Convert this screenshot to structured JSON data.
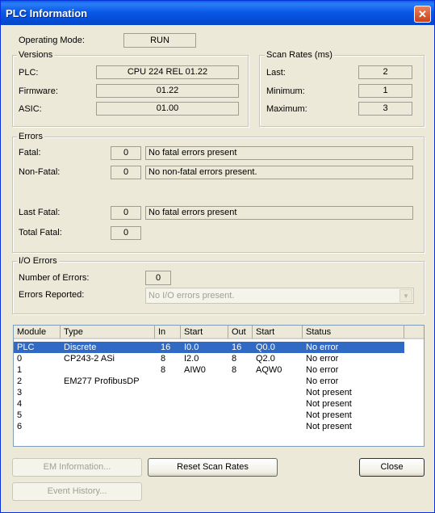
{
  "window": {
    "title": "PLC Information",
    "close_glyph": "✕"
  },
  "operating_mode": {
    "label": "Operating Mode:",
    "value": "RUN"
  },
  "versions": {
    "title": "Versions",
    "plc": {
      "label": "PLC:",
      "value": "CPU 224 REL 01.22"
    },
    "firmware": {
      "label": "Firmware:",
      "value": "01.22"
    },
    "asic": {
      "label": "ASIC:",
      "value": "01.00"
    }
  },
  "scan_rates": {
    "title": "Scan Rates (ms)",
    "last": {
      "label": "Last:",
      "value": "2"
    },
    "minimum": {
      "label": "Minimum:",
      "value": "1"
    },
    "maximum": {
      "label": "Maximum:",
      "value": "3"
    }
  },
  "errors": {
    "title": "Errors",
    "fatal": {
      "label": "Fatal:",
      "count": "0",
      "message": "No fatal errors present"
    },
    "non_fatal": {
      "label": "Non-Fatal:",
      "count": "0",
      "message": "No non-fatal errors present."
    },
    "last_fatal": {
      "label": "Last Fatal:",
      "count": "0",
      "message": "No fatal errors present"
    },
    "total_fatal": {
      "label": "Total Fatal:",
      "count": "0"
    }
  },
  "io_errors": {
    "title": "I/O Errors",
    "number": {
      "label": "Number of Errors:",
      "value": "0"
    },
    "reported": {
      "label": "Errors Reported:",
      "value": "No I/O errors present.",
      "arrow": "▼"
    }
  },
  "modules": {
    "columns": [
      "Module",
      "Type",
      "In",
      "Start",
      "Out",
      "Start",
      "Status"
    ],
    "rows": [
      [
        "PLC",
        "Discrete",
        "16",
        "I0.0",
        "16",
        "Q0.0",
        "No error"
      ],
      [
        "0",
        "CP243-2 ASi",
        "8",
        "I2.0",
        "8",
        "Q2.0",
        "No error"
      ],
      [
        "1",
        "",
        "8",
        "AIW0",
        "8",
        "AQW0",
        "No error"
      ],
      [
        "2",
        "EM277 ProfibusDP",
        "",
        "",
        "",
        "",
        "No error"
      ],
      [
        "3",
        "",
        "",
        "",
        "",
        "",
        "Not present"
      ],
      [
        "4",
        "",
        "",
        "",
        "",
        "",
        "Not present"
      ],
      [
        "5",
        "",
        "",
        "",
        "",
        "",
        "Not present"
      ],
      [
        "6",
        "",
        "",
        "",
        "",
        "",
        "Not present"
      ]
    ],
    "selected_row": 0
  },
  "buttons": {
    "em_information": "EM Information...",
    "reset_scan_rates": "Reset Scan Rates",
    "close": "Close",
    "event_history": "Event History..."
  }
}
